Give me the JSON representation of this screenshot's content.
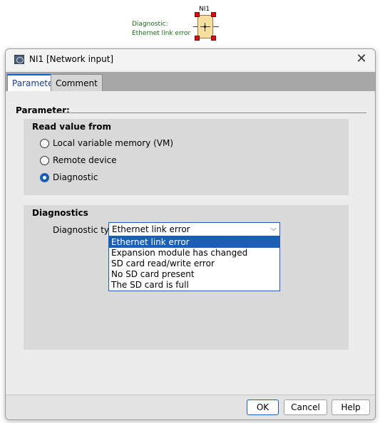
{
  "diagram": {
    "block_name": "NI1",
    "label_line1": "Diagnostic:",
    "label_line2": "Ethernet link error",
    "block_color": "#f7dfa0",
    "handle_color": "#e01010"
  },
  "dialog": {
    "title": "NI1 [Network input]",
    "close_glyph": "✕",
    "tabs": [
      {
        "label": "Parameter",
        "active": true
      },
      {
        "label": "Comment",
        "active": false
      }
    ],
    "parameter_heading": "Parameter:",
    "read_value_group": {
      "title": "Read value from",
      "options": [
        {
          "label": "Local variable memory (VM)",
          "checked": false
        },
        {
          "label": "Remote device",
          "checked": false
        },
        {
          "label": "Diagnostic",
          "checked": true
        }
      ]
    },
    "diagnostics_group": {
      "title": "Diagnostics",
      "type_label": "Diagnostic type:",
      "selected_value": "Ethernet link error",
      "arrow_glyph": "⌵",
      "options": [
        "Ethernet link error",
        "Expansion module has changed",
        "SD card read/write error",
        "No SD card present",
        "The SD card is full"
      ],
      "highlighted_index": 0
    },
    "buttons": {
      "ok": "OK",
      "cancel": "Cancel",
      "help": "Help"
    },
    "accent_color": "#1a5fb4"
  }
}
